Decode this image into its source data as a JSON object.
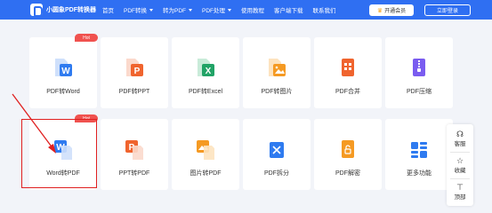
{
  "header": {
    "brand": "小圆象PDF转换器",
    "nav": [
      {
        "label": "首页",
        "dropdown": false
      },
      {
        "label": "PDF转换",
        "dropdown": true
      },
      {
        "label": "转为PDF",
        "dropdown": true
      },
      {
        "label": "PDF处理",
        "dropdown": true
      },
      {
        "label": "使用教程",
        "dropdown": false
      },
      {
        "label": "客户端下载",
        "dropdown": false
      },
      {
        "label": "联系我们",
        "dropdown": false
      }
    ],
    "vip_button": "开通会员",
    "login_button": "立即登录"
  },
  "badge_hot": "Hot",
  "tools_row1": [
    {
      "label": "PDF转Word",
      "icon": "pdf-to-word-icon"
    },
    {
      "label": "PDF转PPT",
      "icon": "pdf-to-ppt-icon"
    },
    {
      "label": "PDF转Excel",
      "icon": "pdf-to-excel-icon"
    },
    {
      "label": "PDF转图片",
      "icon": "pdf-to-image-icon"
    },
    {
      "label": "PDF合并",
      "icon": "pdf-merge-icon"
    },
    {
      "label": "PDF压缩",
      "icon": "pdf-compress-icon"
    }
  ],
  "tools_row2": [
    {
      "label": "Word转PDF",
      "icon": "word-to-pdf-icon"
    },
    {
      "label": "PPT转PDF",
      "icon": "ppt-to-pdf-icon"
    },
    {
      "label": "图片转PDF",
      "icon": "image-to-pdf-icon"
    },
    {
      "label": "PDF拆分",
      "icon": "pdf-split-icon"
    },
    {
      "label": "PDF解密",
      "icon": "pdf-decrypt-icon"
    },
    {
      "label": "更多功能",
      "icon": "more-features-icon"
    }
  ],
  "sidebar": {
    "service": "客服",
    "favorite": "收藏",
    "top": "顶部"
  },
  "colors": {
    "primary": "#2f6ff2",
    "hot": "#f0524f",
    "highlight": "#e02020",
    "word": "#2f7bf0",
    "ppt": "#f0642e",
    "excel": "#21a366",
    "image": "#f59a23",
    "merge": "#f0642e",
    "compress": "#7a5cf0"
  }
}
